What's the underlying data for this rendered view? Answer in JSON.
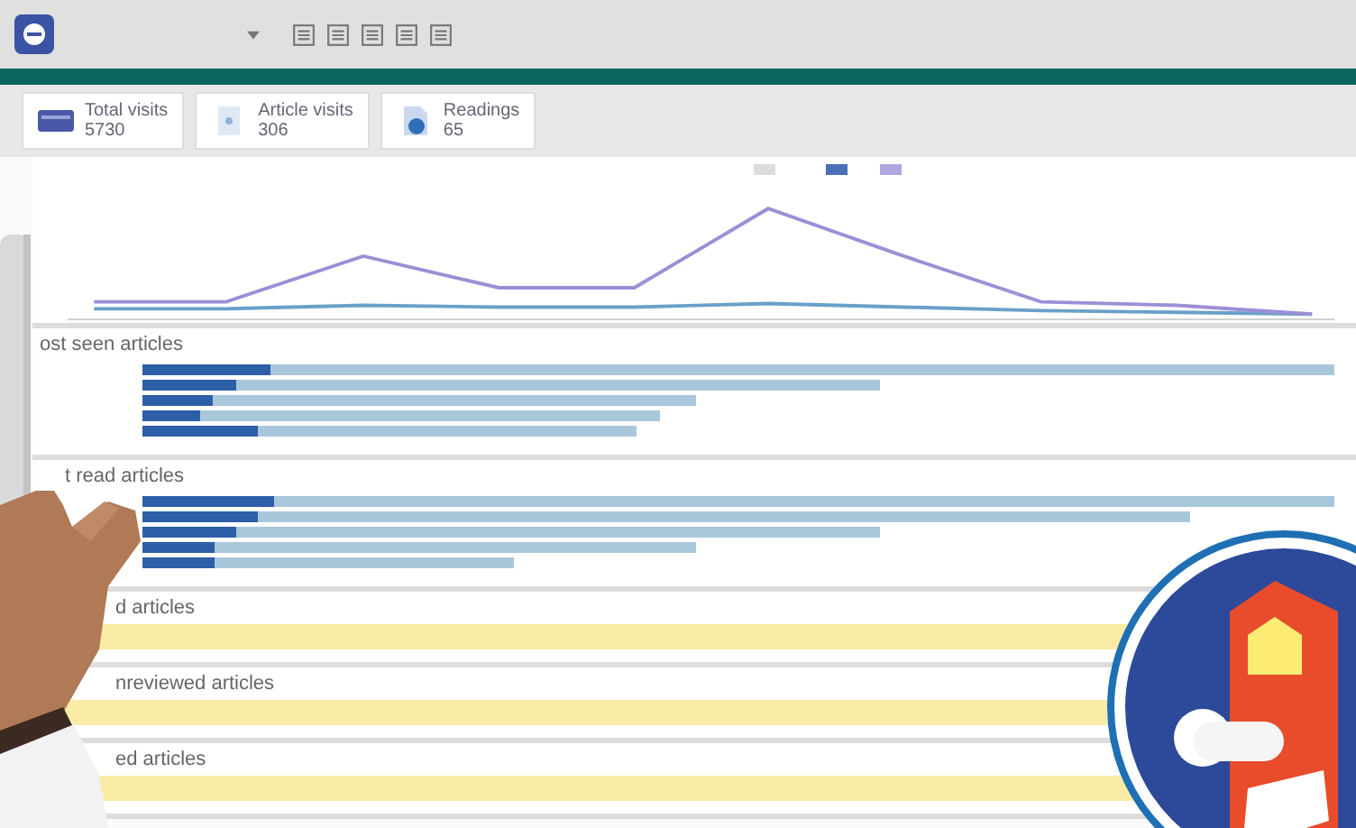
{
  "kpis": [
    {
      "kind": "visits",
      "label": "Total visits",
      "value": "5730"
    },
    {
      "kind": "articles",
      "label": "Article visits",
      "value": "306"
    },
    {
      "kind": "readings",
      "label": "Readings",
      "value": "65"
    }
  ],
  "sections": [
    {
      "kind": "line"
    },
    {
      "kind": "bars",
      "title": "ost seen articles"
    },
    {
      "kind": "bars",
      "title": "t read articles"
    },
    {
      "kind": "notice",
      "title": "d articles"
    },
    {
      "kind": "notice",
      "title": "nreviewed articles"
    },
    {
      "kind": "notice",
      "title": "ed articles"
    }
  ]
}
